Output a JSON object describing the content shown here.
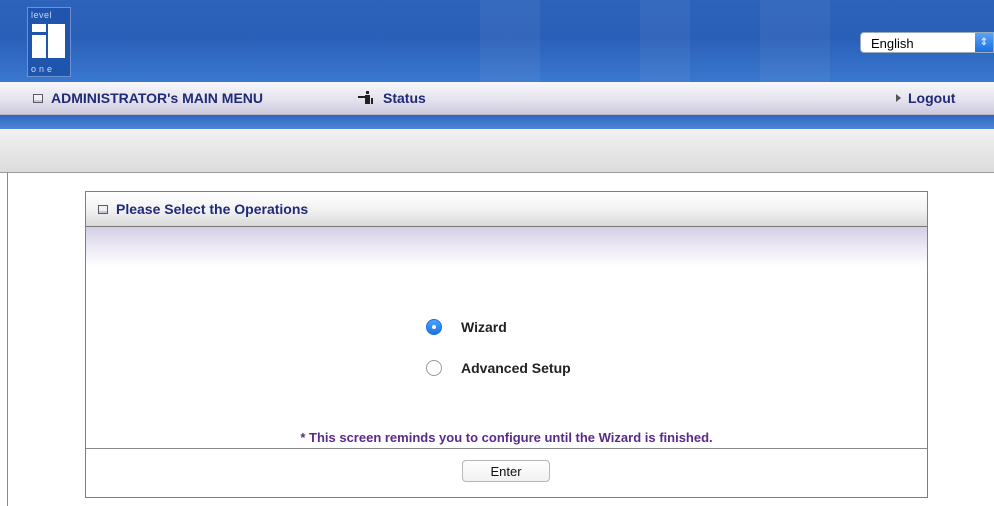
{
  "header": {
    "logo_top": "level",
    "logo_bottom": "one",
    "language": {
      "selected": "English"
    }
  },
  "menu": {
    "main_menu": "ADMINISTRATOR's MAIN MENU",
    "status": "Status",
    "logout": "Logout"
  },
  "panel": {
    "title": "Please Select the Operations",
    "options": [
      {
        "label": "Wizard",
        "selected": true
      },
      {
        "label": "Advanced Setup",
        "selected": false
      }
    ],
    "note": "* This screen reminds you to configure until the Wizard is finished.",
    "enter_label": "Enter"
  },
  "colors": {
    "banner_blue": "#2d63bb",
    "menu_text": "#1f2a78",
    "note_text": "#5a2a8a",
    "radio_selected": "#1a73e8"
  }
}
